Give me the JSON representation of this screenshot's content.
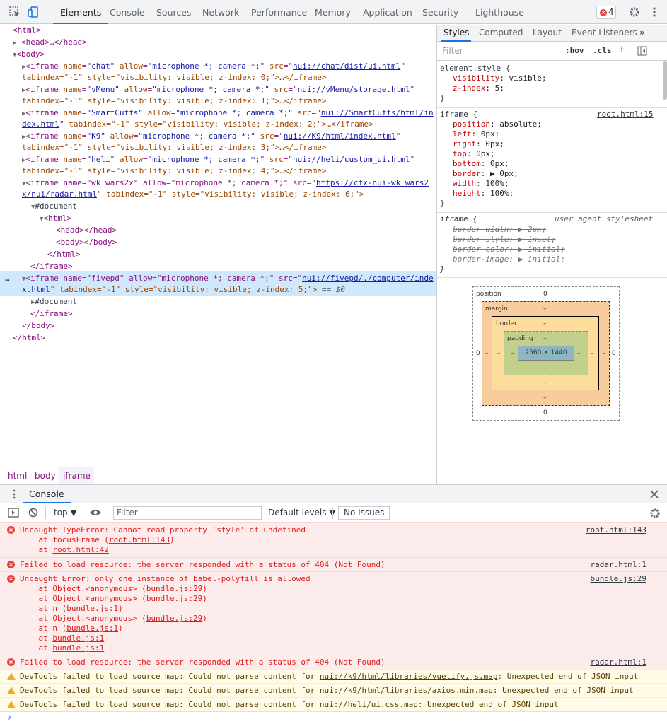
{
  "toolbar": {
    "inspect_icon": "inspect-icon",
    "device_icon": "device-toggle-icon",
    "tabs": [
      "Elements",
      "Console",
      "Sources",
      "Network",
      "Performance",
      "Memory",
      "Application",
      "Security",
      "Lighthouse"
    ],
    "active_tab": "Elements",
    "error_count": "4"
  },
  "dom": {
    "html_open": "<html>",
    "head_collapsed": "<head>…</head>",
    "body_open": "<body>",
    "iframes": [
      {
        "line1_pre": "<iframe ",
        "name_attr": "name",
        "name_val": "\"chat\"",
        "allow_attr": "allow",
        "allow_val": "\"microphone *; camera *;\"",
        "src_attr": "src",
        "src_val": "nui://chat/dist/ui.html",
        "line2": "tabindex=\"-1\" style=\"visibility: visible; z-index: 0;\">…</iframe>"
      },
      {
        "line1_pre": "<iframe ",
        "name_attr": "name",
        "name_val": "\"vMenu\"",
        "allow_attr": "allow",
        "allow_val": "\"microphone *; camera *;\"",
        "src_attr": "src",
        "src_val": "nui://vMenu/storage.html",
        "line2": "tabindex=\"-1\" style=\"visibility: visible; z-index: 1;\">…</iframe>"
      },
      {
        "line1_pre": "<iframe ",
        "name_attr": "name",
        "name_val": "\"SmartCuffs\"",
        "allow_attr": "allow",
        "allow_val": "\"microphone *; camera *;\"",
        "src_attr": "src",
        "src_val": "nui://SmartCuffs/html/in",
        "line2_link": "dex.html",
        "line2": " tabindex=\"-1\" style=\"visibility: visible; z-index: 2;\">…</iframe>"
      },
      {
        "line1_pre": "<iframe ",
        "name_attr": "name",
        "name_val": "\"K9\"",
        "allow_attr": "allow",
        "allow_val": "\"microphone *; camera *;\"",
        "src_attr": "src",
        "src_val": "nui://K9/html/index.html",
        "line2": "tabindex=\"-1\" style=\"visibility: visible; z-index: 3;\">…</iframe>"
      },
      {
        "line1_pre": "<iframe ",
        "name_attr": "name",
        "name_val": "\"heli\"",
        "allow_attr": "allow",
        "allow_val": "\"microphone *; camera *;\"",
        "src_attr": "src",
        "src_val": "nui://heli/custom_ui.html",
        "line2": "tabindex=\"-1\" style=\"visibility: visible; z-index: 4;\">…</iframe>"
      }
    ],
    "wk": {
      "line1": "<iframe name=\"wk_wars2x\" allow=\"microphone *; camera *;\" src=\"",
      "src1": "https://cfx-nui-wk_wars2",
      "src2": "x/nui/radar.html",
      "line2_rest": "\" tabindex=\"-1\" style=\"visibility: visible; z-index: 6;\">",
      "document": "#document",
      "html": "<html>",
      "head": "<head></head>",
      "body": "<body></body>",
      "html_close": "</html>",
      "iframe_close": "</iframe>"
    },
    "selected": {
      "line1": "<iframe name=\"fivepd\" allow=\"microphone *; camera *;\" src=\"",
      "src1": "nui://fivepd/./computer/inde",
      "src2": "x.html",
      "line2_rest": "\" tabindex=\"-1\" style=\"visibility: visible; z-index: 5;\">",
      "eq": "== $0",
      "document": "#document",
      "iframe_close": "</iframe>"
    },
    "body_close": "</body>",
    "html_close": "</html>",
    "ellipsis": "…"
  },
  "breadcrumbs": [
    "html",
    "body",
    "iframe"
  ],
  "styles": {
    "tabs": [
      "Styles",
      "Computed",
      "Layout",
      "Event Listeners"
    ],
    "more": "»",
    "filter_placeholder": "Filter",
    "hov": ":hov",
    "cls": ".cls",
    "plus": "+",
    "element_style": {
      "selector": "element.style {",
      "props": [
        [
          "visibility",
          ": visible;"
        ],
        [
          "z-index",
          ": 5;"
        ]
      ],
      "close": "}"
    },
    "iframe_rule": {
      "selector": "iframe {",
      "source": "root.html:15",
      "props": [
        [
          "position",
          ": absolute;"
        ],
        [
          "left",
          ": 0px;"
        ],
        [
          "right",
          ": 0px;"
        ],
        [
          "top",
          ": 0px;"
        ],
        [
          "bottom",
          ": 0px;"
        ],
        [
          "border",
          ": ▶ 0px;"
        ],
        [
          "width",
          ": 100%;"
        ],
        [
          "height",
          ": 100%;"
        ]
      ],
      "close": "}"
    },
    "ua_rule": {
      "selector": "iframe {",
      "source": "user agent stylesheet",
      "props": [
        "border-width: ▶ 2px;",
        "border-style: ▶ inset;",
        "border-color: ▶ initial;",
        "border-image: ▶ initial;"
      ],
      "close": "}"
    },
    "box_model": {
      "position_label": "position",
      "position_val": "0",
      "margin_label": "margin",
      "border_label": "border",
      "padding_label": "padding",
      "dash": "–",
      "zero": "0",
      "content": "2560 × 1440"
    }
  },
  "console": {
    "drawer_title": "Console",
    "context": "top ▼",
    "filter_placeholder": "Filter",
    "levels": "Default levels ▼",
    "issues": "No Issues",
    "messages": [
      {
        "type": "error",
        "text": "Uncaught TypeError: Cannot read property 'style' of undefined",
        "source": "root.html:143",
        "stack": [
          [
            "    at focusFrame (",
            "root.html:143",
            ")"
          ],
          [
            "    at ",
            "root.html:42",
            ""
          ]
        ]
      },
      {
        "type": "error",
        "text": "Failed to load resource: the server responded with a status of 404 (Not Found)",
        "source": "radar.html:1",
        "stack": []
      },
      {
        "type": "error",
        "text": "Uncaught Error: only one instance of babel-polyfill is allowed",
        "source": "bundle.js:29",
        "stack": [
          [
            "    at Object.<anonymous> (",
            "bundle.js:29",
            ")"
          ],
          [
            "    at Object.<anonymous> (",
            "bundle.js:29",
            ")"
          ],
          [
            "    at n (",
            "bundle.js:1",
            ")"
          ],
          [
            "    at Object.<anonymous> (",
            "bundle.js:29",
            ")"
          ],
          [
            "    at n (",
            "bundle.js:1",
            ")"
          ],
          [
            "    at ",
            "bundle.js:1",
            ""
          ],
          [
            "    at ",
            "bundle.js:1",
            ""
          ]
        ]
      },
      {
        "type": "error",
        "text": "Failed to load resource: the server responded with a status of 404 (Not Found)",
        "source": "radar.html:1",
        "stack": []
      },
      {
        "type": "warn",
        "pre": "DevTools failed to load source map: Could not parse content for ",
        "link": "nui://k9/html/libraries/vuetify.js.map",
        "post": ": Unexpected end of JSON input"
      },
      {
        "type": "warn",
        "pre": "DevTools failed to load source map: Could not parse content for ",
        "link": "nui://k9/html/libraries/axios.min.map",
        "post": ": Unexpected end of JSON input"
      },
      {
        "type": "warn",
        "pre": "DevTools failed to load source map: Could not parse content for ",
        "link": "nui://heli/ui.css.map",
        "post": ": Unexpected end of JSON input"
      }
    ],
    "prompt": "›"
  },
  "colors": {
    "accent": "#1a73e8",
    "error": "#e8433f",
    "warning": "#f2ab26",
    "selected_row": "#cfe8fc"
  }
}
